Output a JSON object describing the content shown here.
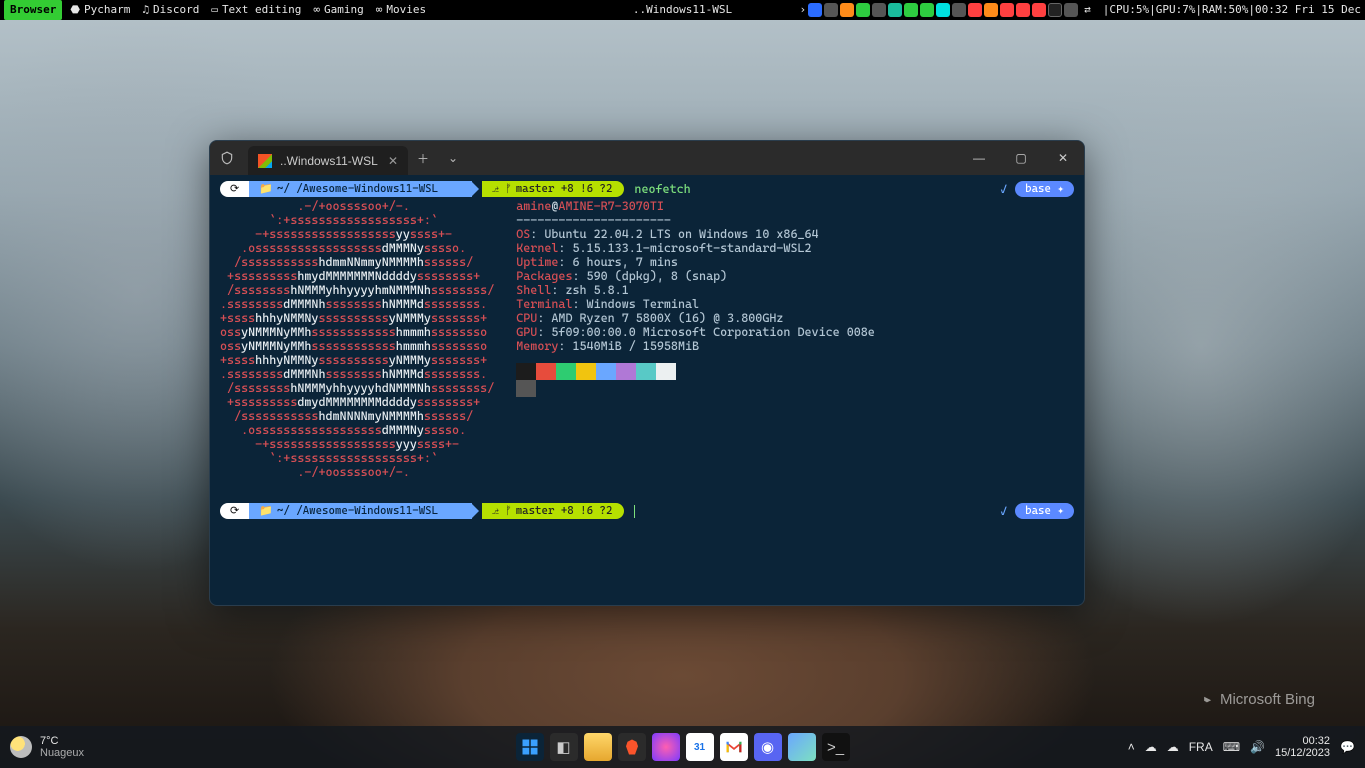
{
  "topbar": {
    "browser": "Browser",
    "items": [
      "Pycharm",
      "Discord",
      "Text editing",
      "Gaming",
      "Movies"
    ],
    "center": "..Windows11-WSL",
    "stats": "|CPU:5%|GPU:7%|RAM:50%|00:32 Fri 15 Dec"
  },
  "terminal": {
    "tab_title": "..Windows11-WSL",
    "prompt_path": "~/ /Awesome-Windows11-WSL",
    "git_status": "master +8 !6 ?2",
    "command": "neofetch",
    "env_badge": "base ✦",
    "neofetch": {
      "user": "amine",
      "host": "AMINE-R7-3070TI",
      "hr": "----------------------",
      "os_key": "OS",
      "os": "Ubuntu 22.04.2 LTS on Windows 10 x86_64",
      "kernel_key": "Kernel",
      "kernel": "5.15.133.1-microsoft-standard-WSL2",
      "uptime_key": "Uptime",
      "uptime": "6 hours, 7 mins",
      "packages_key": "Packages",
      "packages": "590 (dpkg), 8 (snap)",
      "shell_key": "Shell",
      "shell": "zsh 5.8.1",
      "terminal_key": "Terminal",
      "terminal": "Windows Terminal",
      "cpu_key": "CPU",
      "cpu": "AMD Ryzen 7 5800X (16) @ 3.800GHz",
      "gpu_key": "GPU",
      "gpu": "5f09:00:00.0 Microsoft Corporation Device 008e",
      "memory_key": "Memory",
      "memory": "1540MiB / 15958MiB"
    },
    "ascii": [
      {
        "pre": "           ",
        "r": ".-/+oossssoo+/-.",
        "post": ""
      },
      {
        "pre": "       ",
        "r": "`:+ssssssssssssssssss+:`",
        "post": ""
      },
      {
        "pre": "     ",
        "r": "-+ssssssssssssssssss",
        "w": "yy",
        "r2": "ssss+-",
        "post": ""
      },
      {
        "pre": "   ",
        "r": ".ossssssssssssssssss",
        "w": "dMMMNy",
        "r2": "sssso.",
        "post": ""
      },
      {
        "pre": "  ",
        "r": "/sssssssssss",
        "w": "hdmmNNmmyNMMMMh",
        "r2": "ssssss/",
        "post": ""
      },
      {
        "pre": " ",
        "r": "+sssssssss",
        "w": "hmydMMMMMMMNddddy",
        "r2": "ssssssss+",
        "post": ""
      },
      {
        "pre": " ",
        "r": "/ssssssss",
        "w": "hNMMMyhhyyyyhmNMMMNh",
        "r2": "ssssssss/",
        "post": ""
      },
      {
        "pre": "",
        "r": ".ssssssss",
        "w": "dMMMNh",
        "r2": "ssssssss",
        "w2": "hNMMMd",
        "r3": "ssssssss.",
        "post": ""
      },
      {
        "pre": "",
        "r": "+ssss",
        "w": "hhhyNMMNy",
        "r2": "ssssssssss",
        "w2": "yNMMMy",
        "r3": "sssssss+",
        "post": ""
      },
      {
        "pre": "",
        "r": "oss",
        "w": "yNMMMNyMMh",
        "r2": "ssssssssssss",
        "w2": "hmmmh",
        "r3": "ssssssso",
        "post": ""
      },
      {
        "pre": "",
        "r": "oss",
        "w": "yNMMMNyMMh",
        "r2": "ssssssssssss",
        "w2": "hmmmh",
        "r3": "ssssssso",
        "post": ""
      },
      {
        "pre": "",
        "r": "+ssss",
        "w": "hhhyNMMNy",
        "r2": "ssssssssss",
        "w2": "yNMMMy",
        "r3": "sssssss+",
        "post": ""
      },
      {
        "pre": "",
        "r": ".ssssssss",
        "w": "dMMMNh",
        "r2": "ssssssss",
        "w2": "hNMMMd",
        "r3": "ssssssss.",
        "post": ""
      },
      {
        "pre": " ",
        "r": "/ssssssss",
        "w": "hNMMMyhhyyyyhdNMMMNh",
        "r2": "ssssssss/",
        "post": ""
      },
      {
        "pre": " ",
        "r": "+sssssssss",
        "w": "dmydMMMMMMMMddddy",
        "r2": "ssssssss+",
        "post": ""
      },
      {
        "pre": "  ",
        "r": "/sssssssssss",
        "w": "hdmNNNNmyNMMMMh",
        "r2": "ssssss/",
        "post": ""
      },
      {
        "pre": "   ",
        "r": ".ossssssssssssssssss",
        "w": "dMMMNy",
        "r2": "sssso.",
        "post": ""
      },
      {
        "pre": "     ",
        "r": "-+ssssssssssssssssss",
        "w": "yyy",
        "r2": "ssss+-",
        "post": ""
      },
      {
        "pre": "       ",
        "r": "`:+ssssssssssssssssss+:`",
        "post": ""
      },
      {
        "pre": "           ",
        "r": ".-/+oossssoo+/-.",
        "post": ""
      }
    ]
  },
  "taskbar": {
    "weather_temp": "7°C",
    "weather_desc": "Nuageux",
    "lang": "FRA",
    "time": "00:32",
    "date": "15/12/2023",
    "calendar_day": "31"
  },
  "bing": "Microsoft Bing"
}
